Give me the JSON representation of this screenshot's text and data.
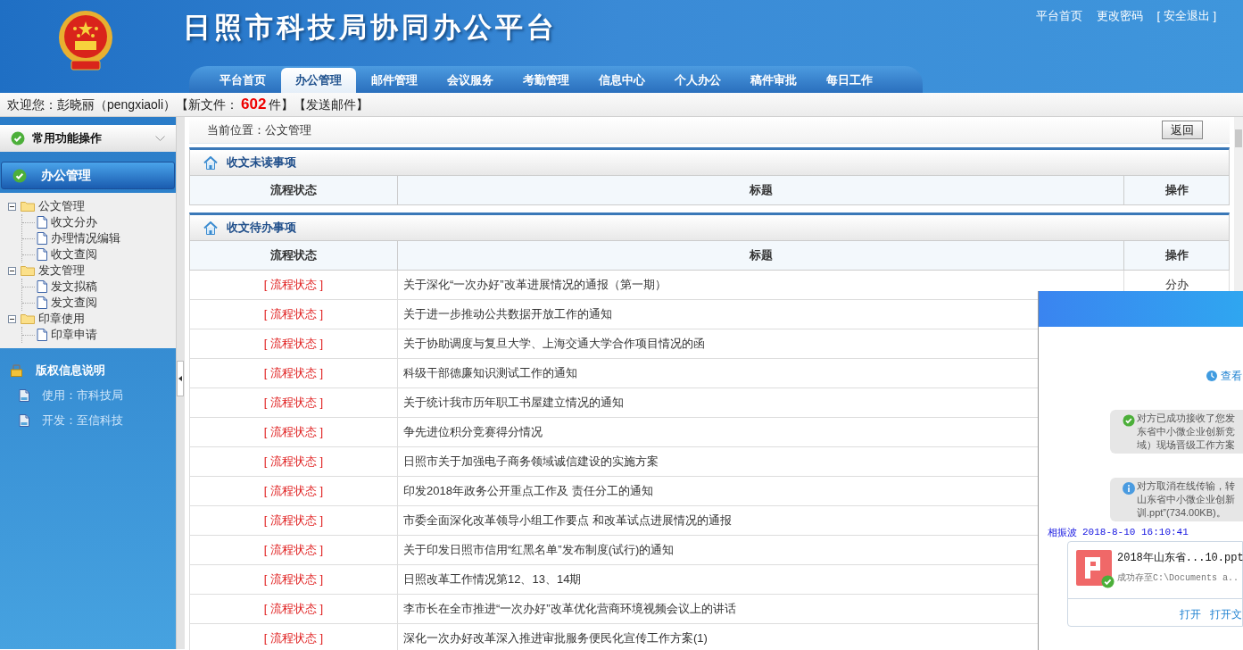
{
  "header": {
    "title": "日照市科技局协同办公平台",
    "links": [
      "平台首页",
      "更改密码",
      "[ 安全退出 ]"
    ]
  },
  "tabs": [
    {
      "label": "平台首页",
      "selected": false
    },
    {
      "label": "办公管理",
      "selected": true
    },
    {
      "label": "邮件管理",
      "selected": false
    },
    {
      "label": "会议服务",
      "selected": false
    },
    {
      "label": "考勤管理",
      "selected": false
    },
    {
      "label": "信息中心",
      "selected": false
    },
    {
      "label": "个人办公",
      "selected": false
    },
    {
      "label": "稿件审批",
      "selected": false
    },
    {
      "label": "每日工作",
      "selected": false
    }
  ],
  "welcome": {
    "greeting": "欢迎您：彭晓丽（pengxiaoli）",
    "new_files_label": "【新文件：",
    "new_files_count": "602",
    "new_files_unit": "件】",
    "send_mail": "【发送邮件】"
  },
  "sidebar": {
    "common_ops": "常用功能操作",
    "section": "办公管理",
    "tree": [
      {
        "label": "公文管理",
        "expanded": true,
        "children": [
          {
            "label": "收文分办"
          },
          {
            "label": "办理情况编辑"
          },
          {
            "label": "收文查阅"
          }
        ]
      },
      {
        "label": "发文管理",
        "expanded": true,
        "children": [
          {
            "label": "发文拟稿"
          },
          {
            "label": "发文查阅"
          }
        ]
      },
      {
        "label": "印章使用",
        "expanded": true,
        "children": [
          {
            "label": "印章申请"
          }
        ]
      }
    ],
    "copyright_title": "版权信息说明",
    "copyright_items": [
      "使用：市科技局",
      "开发：至信科技"
    ]
  },
  "breadcrumb": "当前位置：公文管理",
  "back_button": "返回",
  "unread": {
    "title": "收文未读事项",
    "columns": [
      "流程状态",
      "标题",
      "操作"
    ]
  },
  "pending": {
    "title": "收文待办事项",
    "columns": [
      "流程状态",
      "标题",
      "操作"
    ],
    "rows": [
      {
        "status": "[ 流程状态 ]",
        "title": "关于深化“一次办好”改革进展情况的通报（第一期）",
        "operation": "分办"
      },
      {
        "status": "[ 流程状态 ]",
        "title": "关于进一步推动公共数据开放工作的通知"
      },
      {
        "status": "[ 流程状态 ]",
        "title": "关于协助调度与复旦大学、上海交通大学合作项目情况的函"
      },
      {
        "status": "[ 流程状态 ]",
        "title": "科级干部德廉知识测试工作的通知"
      },
      {
        "status": "[ 流程状态 ]",
        "title": "关于统计我市历年职工书屋建立情况的通知"
      },
      {
        "status": "[ 流程状态 ]",
        "title": "争先进位积分竞赛得分情况"
      },
      {
        "status": "[ 流程状态 ]",
        "title": "日照市关于加强电子商务领域诚信建设的实施方案"
      },
      {
        "status": "[ 流程状态 ]",
        "title": "印发2018年政务公开重点工作及 责任分工的通知"
      },
      {
        "status": "[ 流程状态 ]",
        "title": "市委全面深化改革领导小组工作要点 和改革试点进展情况的通报"
      },
      {
        "status": "[ 流程状态 ]",
        "title": "关于印发日照市信用“红黑名单”发布制度(试行)的通知"
      },
      {
        "status": "[ 流程状态 ]",
        "title": "日照改革工作情况第12、13、14期"
      },
      {
        "status": "[ 流程状态 ]",
        "title": "李市长在全市推进“一次办好”改革优化营商环境视频会议上的讲话"
      },
      {
        "status": "[ 流程状态 ]",
        "title": "深化一次办好改革深入推进审批服务便民化宣传工作方案(1)"
      }
    ]
  },
  "chat": {
    "history_link": "查看",
    "notices": [
      {
        "kind": "success",
        "lines": [
          "对方已成功接收了您发",
          "东省中小微企业创新竞",
          "域）现场晋级工作方案"
        ]
      },
      {
        "kind": "info",
        "lines": [
          "对方取消在线传输，转",
          "山东省中小微企业创新",
          "训.ppt”(734.00KB)。"
        ]
      }
    ],
    "sender": "相振波",
    "time": "2018-8-10 16:10:41",
    "file": {
      "name": "2018年山东省...10.ppt",
      "status": "成功存至C:\\Documents a..",
      "actions": [
        "打开",
        "打开文"
      ]
    }
  }
}
